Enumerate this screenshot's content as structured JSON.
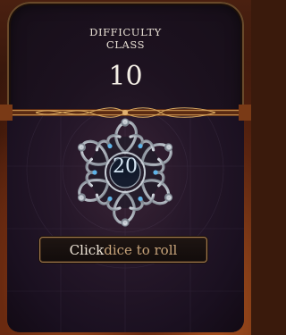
{
  "difficulty": {
    "label_line1": "DIFFICULTY",
    "label_line2": "CLASS",
    "value": "10"
  },
  "die": {
    "face_value": "20",
    "icon": "ornate-d20-dice-icon"
  },
  "roll_button": {
    "label_prefix": "Click",
    "label_suffix": " dice to roll"
  },
  "colors": {
    "frame": "#6a2c12",
    "panel": "#1d1220",
    "button_border": "#a07a4c",
    "gold_text": "#c8a47a",
    "die_silver": "#d8dde4",
    "gem_blue": "#5fb4e8"
  }
}
